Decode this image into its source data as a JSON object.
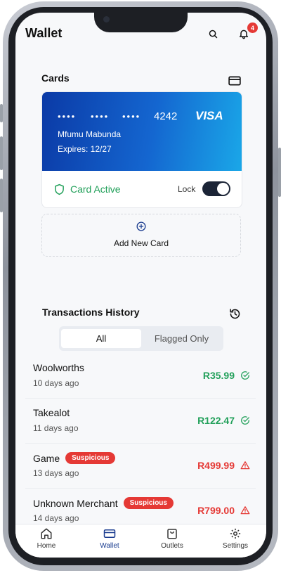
{
  "header": {
    "title": "Wallet",
    "notification_count": "4"
  },
  "cards_section": {
    "title": "Cards",
    "card": {
      "masked_groups": [
        "••••",
        "••••",
        "••••"
      ],
      "last4": "4242",
      "brand": "VISA",
      "holder": "Mfumu Mabunda",
      "expires": "Expires: 12/27",
      "status": "Card Active",
      "lock_label": "Lock",
      "locked": true
    },
    "add_card_label": "Add New Card"
  },
  "transactions": {
    "title": "Transactions History",
    "filters": [
      "All",
      "Flagged Only"
    ],
    "selected_filter": "All",
    "items": [
      {
        "merchant": "Woolworths",
        "time": "10 days ago",
        "amount": "R35.99",
        "flag": "",
        "status": "ok"
      },
      {
        "merchant": "Takealot",
        "time": "11 days ago",
        "amount": "R122.47",
        "flag": "",
        "status": "ok"
      },
      {
        "merchant": "Game",
        "time": "13 days ago",
        "amount": "R499.99",
        "flag": "Suspicious",
        "status": "warning"
      },
      {
        "merchant": "Unknown Merchant",
        "time": "14 days ago",
        "amount": "R799.00",
        "flag": "Suspicious",
        "status": "warning"
      }
    ]
  },
  "nav": {
    "items": [
      "Home",
      "Wallet",
      "Outlets",
      "Settings"
    ],
    "active": "Wallet"
  },
  "colors": {
    "ok": "#22a05a",
    "danger": "#e53935",
    "accent": "#1a3c8f"
  }
}
